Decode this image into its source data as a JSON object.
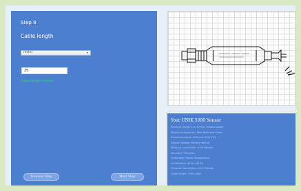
{
  "wizard": {
    "step_title": "Step 9",
    "step_subtitle": "Cable length",
    "unit_select_value": "meter",
    "length_value": "25",
    "length_note": "Cable length (meter)",
    "prev_label": "Previous Step",
    "next_label": "Next Step"
  },
  "summary": {
    "title": "Your UNIK 5000 Sensor",
    "lines": [
      "Pressure range: 0 to 10 bar, Sealed Gauge",
      "Electrical connector: Mini Bulkhead Cable",
      "Electrical output: 4-20 mA (0 to 5 V)",
      "Output voltage: Factory default",
      "Pressure connection: G1/4 Female",
      "Accuracy: Premium",
      "Calibration: Room Temperature",
      "Certification: ATEX / IECEx",
      "Pressure Connection: G1/4 Female",
      "Cable length: 25m cable"
    ]
  }
}
